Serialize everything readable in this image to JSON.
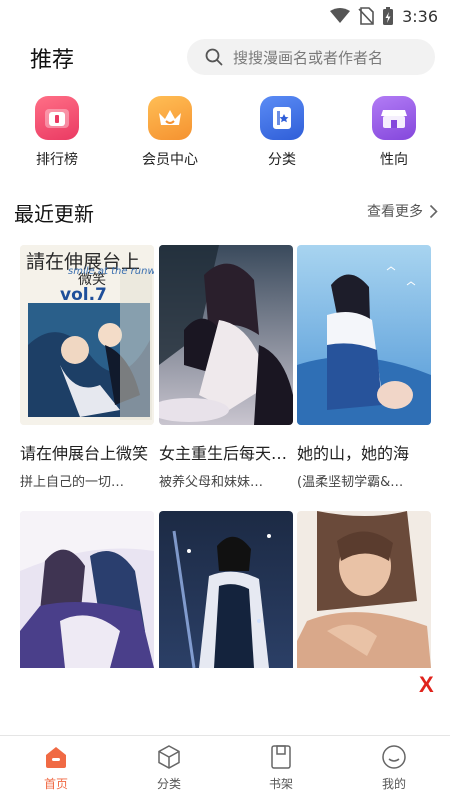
{
  "status_bar": {
    "time": "3:36",
    "icons": [
      "wifi-icon",
      "no-sim-icon",
      "battery-charging-icon"
    ]
  },
  "header": {
    "title": "推荐",
    "search": {
      "placeholder": "搜搜漫画名或者作者名",
      "icon": "search-icon"
    }
  },
  "quick_nav": [
    {
      "label": "排行榜",
      "icon": "ranking-icon",
      "color": "#f04a6e"
    },
    {
      "label": "会员中心",
      "icon": "crown-icon",
      "color": "#f7a23b"
    },
    {
      "label": "分类",
      "icon": "category-icon",
      "color": "#3f72e8"
    },
    {
      "label": "性向",
      "icon": "shop-icon",
      "color": "#9a5ce6"
    }
  ],
  "recent_updates": {
    "title": "最近更新",
    "more_label": "查看更多",
    "items": [
      {
        "title": "请在伸展台上微笑",
        "subtitle": "拼上自己的一切…",
        "cover_text_1": "請在伸展台上",
        "cover_text_2": "微笑",
        "cover_text_3": "smile at the runway",
        "cover_text_4": "vol.7"
      },
      {
        "title": "女主重生后每天都在…",
        "subtitle": "被养父母和妹妹…"
      },
      {
        "title": "她的山，她的海",
        "subtitle": "(温柔坚韧学霸&…"
      }
    ],
    "row2": [
      {
        "cover": "cover-4"
      },
      {
        "cover": "cover-5"
      },
      {
        "cover": "cover-6"
      }
    ]
  },
  "ad": {
    "close_label": "X"
  },
  "tab_bar": [
    {
      "label": "首页",
      "icon": "home-icon",
      "active": true
    },
    {
      "label": "分类",
      "icon": "cube-icon",
      "active": false
    },
    {
      "label": "书架",
      "icon": "bookshelf-icon",
      "active": false
    },
    {
      "label": "我的",
      "icon": "profile-icon",
      "active": false
    }
  ],
  "colors": {
    "accent": "#f06a44",
    "close": "#e0231c"
  }
}
